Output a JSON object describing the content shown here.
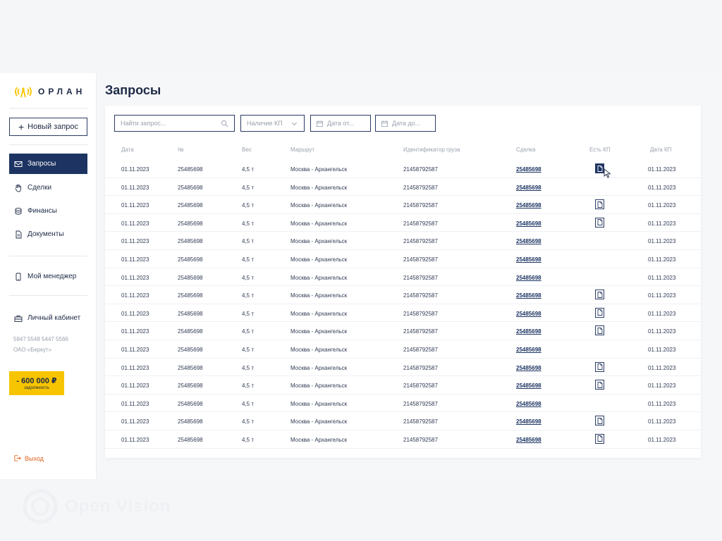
{
  "brand": {
    "name": "ОРЛАН"
  },
  "sidebar": {
    "new_request": "Новый запрос",
    "items": [
      {
        "label": "Запросы",
        "icon": "mail-icon",
        "active": true
      },
      {
        "label": "Сделки",
        "icon": "hand-icon"
      },
      {
        "label": "Финансы",
        "icon": "coins-icon"
      },
      {
        "label": "Документы",
        "icon": "document-icon"
      }
    ],
    "manager": "Мой менеджер",
    "account": "Личный кабинет",
    "account_number": "5847 5548 5447 5566",
    "company": "ОАО «Беркут»",
    "debt_amount": "- 600 000 ₽",
    "debt_label": "задолжность",
    "logout": "Выход"
  },
  "main": {
    "title": "Запросы",
    "filters": {
      "search_placeholder": "Найти запрос...",
      "kp_select": "Наличие КП",
      "date_from": "Дата от...",
      "date_to": "Дата до..."
    },
    "columns": [
      "Дата",
      "№",
      "Вес",
      "Маршрут",
      "Идентификатор груза",
      "Сделка",
      "Есть КП",
      "Дата КП"
    ],
    "rows": [
      {
        "date": "01.11.2023",
        "num": "25485698",
        "weight": "4,5 т",
        "route": "Москва - Архангельск",
        "cargo_id": "21458792587",
        "deal": "25485698",
        "kp": "filled",
        "kp_date": "01.11.2023"
      },
      {
        "date": "01.11.2023",
        "num": "25485698",
        "weight": "4,5 т",
        "route": "Москва - Архангельск",
        "cargo_id": "21458792587",
        "deal": "25485698",
        "kp": "none",
        "kp_date": "01.11.2023"
      },
      {
        "date": "01.11.2023",
        "num": "25485698",
        "weight": "4,5 т",
        "route": "Москва - Архангельск",
        "cargo_id": "21458792587",
        "deal": "25485698",
        "kp": "outline",
        "kp_date": "01.11.2023"
      },
      {
        "date": "01.11.2023",
        "num": "25485698",
        "weight": "4,5 т",
        "route": "Москва - Архангельск",
        "cargo_id": "21458792587",
        "deal": "25485698",
        "kp": "outline",
        "kp_date": "01.11.2023"
      },
      {
        "date": "01.11.2023",
        "num": "25485698",
        "weight": "4,5 т",
        "route": "Москва - Архангельск",
        "cargo_id": "21458792587",
        "deal": "25485698",
        "kp": "none",
        "kp_date": "01.11.2023"
      },
      {
        "date": "01.11.2023",
        "num": "25485698",
        "weight": "4,5 т",
        "route": "Москва - Архангельск",
        "cargo_id": "21458792587",
        "deal": "25485698",
        "kp": "none",
        "kp_date": "01.11.2023"
      },
      {
        "date": "01.11.2023",
        "num": "25485698",
        "weight": "4,5 т",
        "route": "Москва - Архангельск",
        "cargo_id": "21458792587",
        "deal": "25485698",
        "kp": "none",
        "kp_date": "01.11.2023"
      },
      {
        "date": "01.11.2023",
        "num": "25485698",
        "weight": "4,5 т",
        "route": "Москва - Архангельск",
        "cargo_id": "21458792587",
        "deal": "25485698",
        "kp": "outline",
        "kp_date": "01.11.2023"
      },
      {
        "date": "01.11.2023",
        "num": "25485698",
        "weight": "4,5 т",
        "route": "Москва - Архангельск",
        "cargo_id": "21458792587",
        "deal": "25485698",
        "kp": "outline",
        "kp_date": "01.11.2023"
      },
      {
        "date": "01.11.2023",
        "num": "25485698",
        "weight": "4,5 т",
        "route": "Москва - Архангельск",
        "cargo_id": "21458792587",
        "deal": "25485698",
        "kp": "outline",
        "kp_date": "01.11.2023"
      },
      {
        "date": "01.11.2023",
        "num": "25485698",
        "weight": "4,5 т",
        "route": "Москва - Архангельск",
        "cargo_id": "21458792587",
        "deal": "25485698",
        "kp": "none",
        "kp_date": "01.11.2023"
      },
      {
        "date": "01.11.2023",
        "num": "25485698",
        "weight": "4,5 т",
        "route": "Москва - Архангельск",
        "cargo_id": "21458792587",
        "deal": "25485698",
        "kp": "outline",
        "kp_date": "01.11.2023"
      },
      {
        "date": "01.11.2023",
        "num": "25485698",
        "weight": "4,5 т",
        "route": "Москва - Архангельск",
        "cargo_id": "21458792587",
        "deal": "25485698",
        "kp": "outline",
        "kp_date": "01.11.2023"
      },
      {
        "date": "01.11.2023",
        "num": "25485698",
        "weight": "4,5 т",
        "route": "Москва - Архангельск",
        "cargo_id": "21458792587",
        "deal": "25485698",
        "kp": "none",
        "kp_date": "01.11.2023"
      },
      {
        "date": "01.11.2023",
        "num": "25485698",
        "weight": "4,5 т",
        "route": "Москва - Архангельск",
        "cargo_id": "21458792587",
        "deal": "25485698",
        "kp": "outline",
        "kp_date": "01.11.2023"
      },
      {
        "date": "01.11.2023",
        "num": "25485698",
        "weight": "4,5 т",
        "route": "Москва - Архангельск",
        "cargo_id": "21458792587",
        "deal": "25485698",
        "kp": "outline",
        "kp_date": "01.11.2023"
      }
    ]
  },
  "watermark": {
    "text": "Open Vision"
  },
  "colors": {
    "primary": "#1d3462",
    "accent": "#f7c400",
    "logout": "#e2631d",
    "muted": "#9aa1ad"
  }
}
